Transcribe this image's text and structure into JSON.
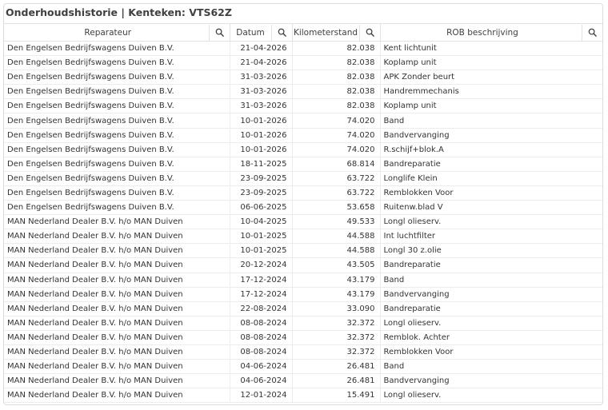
{
  "title": "Onderhoudshistorie | Kenteken: VTS62Z",
  "columns": {
    "reparateur": "Reparateur",
    "datum": "Datum",
    "kilometerstand": "Kilometerstand",
    "rob": "ROB beschrijving"
  },
  "icons": {
    "search": "search-icon"
  },
  "rows": [
    {
      "reparateur": "Den Engelsen Bedrijfswagens Duiven B.V.",
      "datum": "21-04-2026",
      "km": "82.038",
      "rob": "Kent lichtunit"
    },
    {
      "reparateur": "Den Engelsen Bedrijfswagens Duiven B.V.",
      "datum": "21-04-2026",
      "km": "82.038",
      "rob": "Koplamp unit"
    },
    {
      "reparateur": "Den Engelsen Bedrijfswagens Duiven B.V.",
      "datum": "31-03-2026",
      "km": "82.038",
      "rob": "APK Zonder beurt"
    },
    {
      "reparateur": "Den Engelsen Bedrijfswagens Duiven B.V.",
      "datum": "31-03-2026",
      "km": "82.038",
      "rob": "Handremmechanis"
    },
    {
      "reparateur": "Den Engelsen Bedrijfswagens Duiven B.V.",
      "datum": "31-03-2026",
      "km": "82.038",
      "rob": "Koplamp unit"
    },
    {
      "reparateur": "Den Engelsen Bedrijfswagens Duiven B.V.",
      "datum": "10-01-2026",
      "km": "74.020",
      "rob": "Band"
    },
    {
      "reparateur": "Den Engelsen Bedrijfswagens Duiven B.V.",
      "datum": "10-01-2026",
      "km": "74.020",
      "rob": "Bandvervanging"
    },
    {
      "reparateur": "Den Engelsen Bedrijfswagens Duiven B.V.",
      "datum": "10-01-2026",
      "km": "74.020",
      "rob": "R.schijf+blok.A"
    },
    {
      "reparateur": "Den Engelsen Bedrijfswagens Duiven B.V.",
      "datum": "18-11-2025",
      "km": "68.814",
      "rob": "Bandreparatie"
    },
    {
      "reparateur": "Den Engelsen Bedrijfswagens Duiven B.V.",
      "datum": "23-09-2025",
      "km": "63.722",
      "rob": "Longlife Klein"
    },
    {
      "reparateur": "Den Engelsen Bedrijfswagens Duiven B.V.",
      "datum": "23-09-2025",
      "km": "63.722",
      "rob": "Remblokken Voor"
    },
    {
      "reparateur": "Den Engelsen Bedrijfswagens Duiven B.V.",
      "datum": "06-06-2025",
      "km": "53.658",
      "rob": "Ruitenw.blad V"
    },
    {
      "reparateur": "MAN Nederland Dealer B.V. h/o MAN Duiven",
      "datum": "10-04-2025",
      "km": "49.533",
      "rob": "Longl olieserv."
    },
    {
      "reparateur": "MAN Nederland Dealer B.V. h/o MAN Duiven",
      "datum": "10-01-2025",
      "km": "44.588",
      "rob": "Int luchtfilter"
    },
    {
      "reparateur": "MAN Nederland Dealer B.V. h/o MAN Duiven",
      "datum": "10-01-2025",
      "km": "44.588",
      "rob": "Longl 30 z.olie"
    },
    {
      "reparateur": "MAN Nederland Dealer B.V. h/o MAN Duiven",
      "datum": "20-12-2024",
      "km": "43.505",
      "rob": "Bandreparatie"
    },
    {
      "reparateur": "MAN Nederland Dealer B.V. h/o MAN Duiven",
      "datum": "17-12-2024",
      "km": "43.179",
      "rob": "Band"
    },
    {
      "reparateur": "MAN Nederland Dealer B.V. h/o MAN Duiven",
      "datum": "17-12-2024",
      "km": "43.179",
      "rob": "Bandvervanging"
    },
    {
      "reparateur": "MAN Nederland Dealer B.V. h/o MAN Duiven",
      "datum": "22-08-2024",
      "km": "33.090",
      "rob": "Bandreparatie"
    },
    {
      "reparateur": "MAN Nederland Dealer B.V. h/o MAN Duiven",
      "datum": "08-08-2024",
      "km": "32.372",
      "rob": "Longl olieserv."
    },
    {
      "reparateur": "MAN Nederland Dealer B.V. h/o MAN Duiven",
      "datum": "08-08-2024",
      "km": "32.372",
      "rob": "Remblok. Achter"
    },
    {
      "reparateur": "MAN Nederland Dealer B.V. h/o MAN Duiven",
      "datum": "08-08-2024",
      "km": "32.372",
      "rob": "Remblokken Voor"
    },
    {
      "reparateur": "MAN Nederland Dealer B.V. h/o MAN Duiven",
      "datum": "04-06-2024",
      "km": "26.481",
      "rob": "Band"
    },
    {
      "reparateur": "MAN Nederland Dealer B.V. h/o MAN Duiven",
      "datum": "04-06-2024",
      "km": "26.481",
      "rob": "Bandvervanging"
    },
    {
      "reparateur": "MAN Nederland Dealer B.V. h/o MAN Duiven",
      "datum": "12-01-2024",
      "km": "15.491",
      "rob": "Longl olieserv."
    }
  ]
}
